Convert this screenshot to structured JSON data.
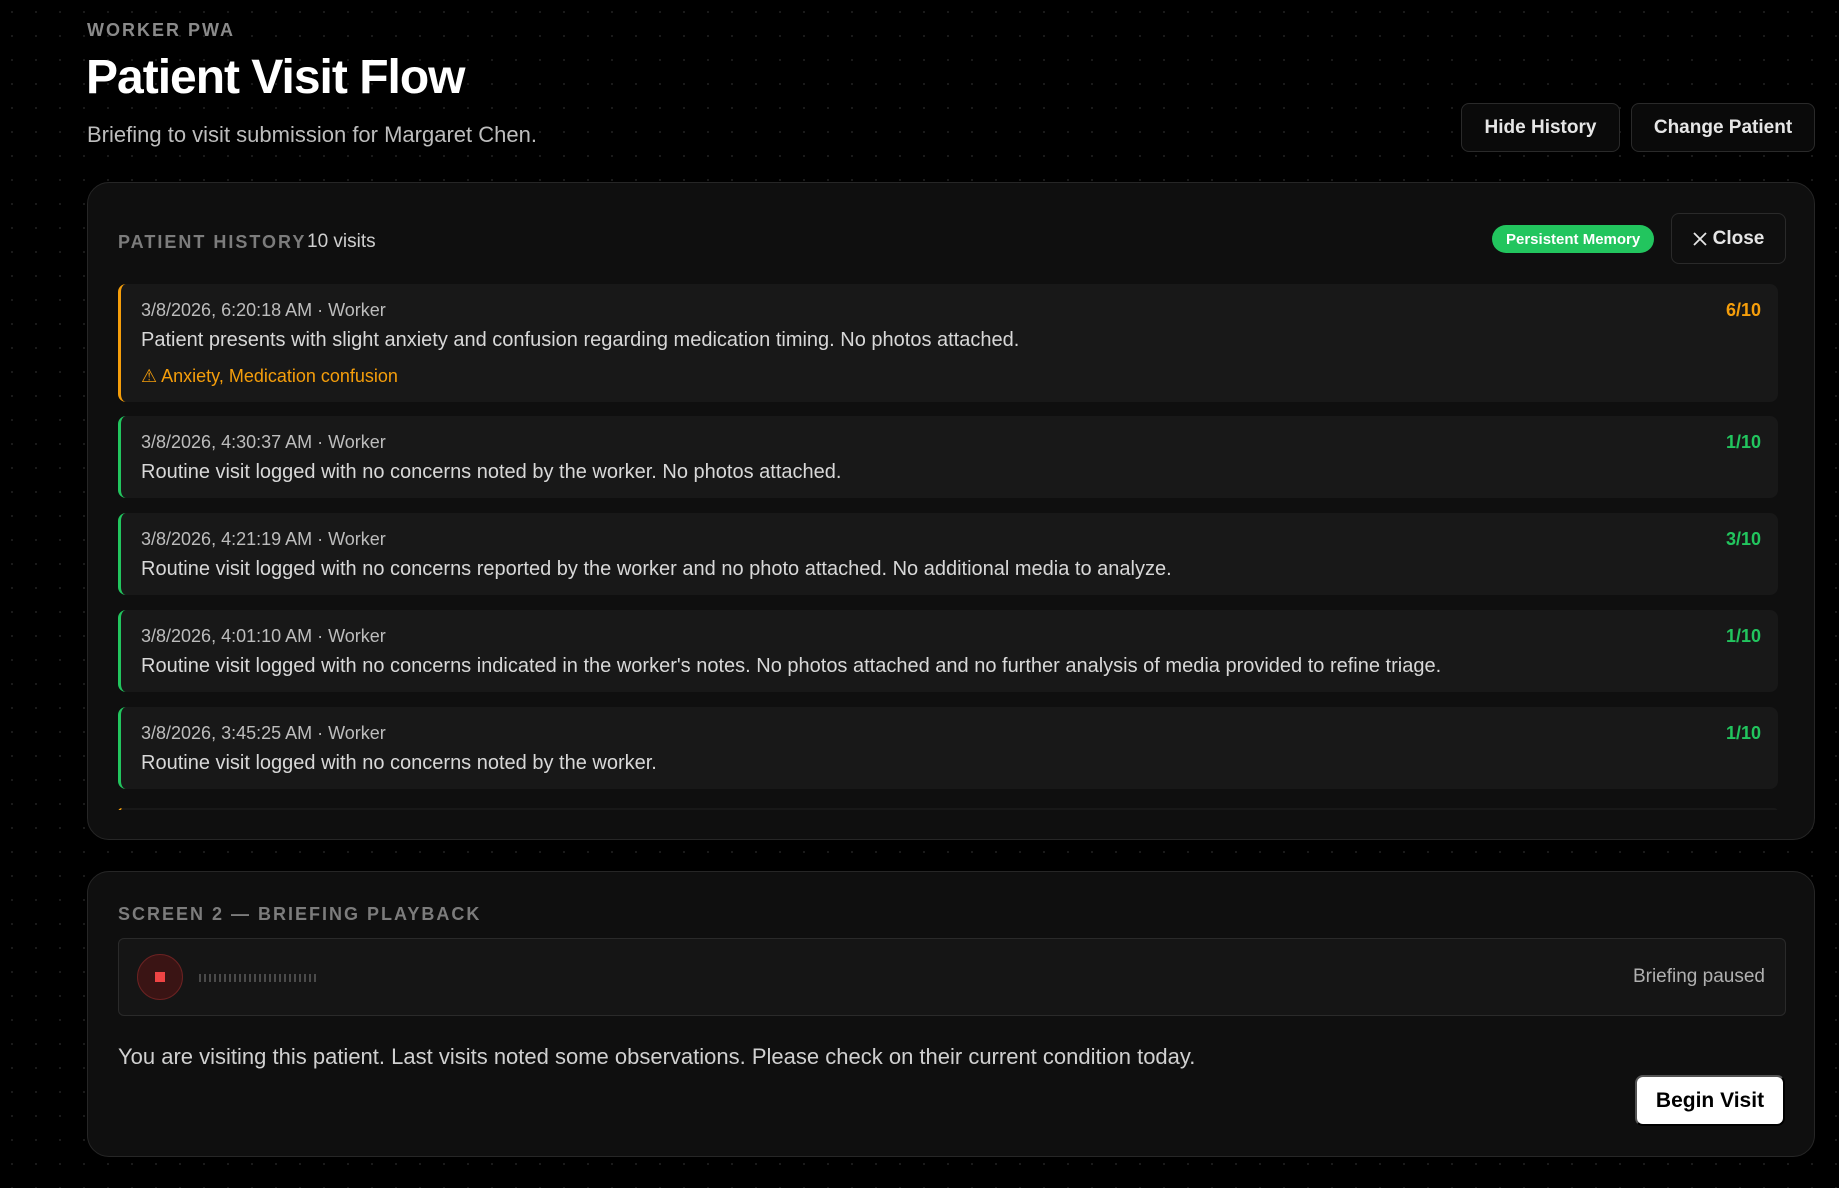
{
  "header": {
    "eyebrow": "WORKER PWA",
    "title": "Patient Visit Flow",
    "subtitle": "Briefing to visit submission for Margaret Chen.",
    "hide_history_label": "Hide History",
    "change_patient_label": "Change Patient"
  },
  "history": {
    "label": "PATIENT HISTORY",
    "count": "10 visits",
    "badge": "Persistent Memory",
    "close_label": "Close",
    "visits": [
      {
        "meta": "3/8/2026, 6:20:18 AM · Worker",
        "text": "Patient presents with slight anxiety and confusion regarding medication timing. No photos attached.",
        "score": "6/10",
        "flags": "Anxiety, Medication confusion"
      },
      {
        "meta": "3/8/2026, 4:30:37 AM · Worker",
        "text": "Routine visit logged with no concerns noted by the worker. No photos attached.",
        "score": "1/10"
      },
      {
        "meta": "3/8/2026, 4:21:19 AM · Worker",
        "text": "Routine visit logged with no concerns reported by the worker and no photo attached. No additional media to analyze.",
        "score": "3/10"
      },
      {
        "meta": "3/8/2026, 4:01:10 AM · Worker",
        "text": "Routine visit logged with no concerns indicated in the worker's notes. No photos attached and no further analysis of media provided to refine triage.",
        "score": "1/10"
      },
      {
        "meta": "3/8/2026, 3:45:25 AM · Worker",
        "text": "Routine visit logged with no concerns noted by the worker.",
        "score": "1/10"
      }
    ]
  },
  "briefing": {
    "label": "SCREEN 2 — BRIEFING PLAYBACK",
    "status": "Briefing paused",
    "text": "You are visiting this patient. Last visits noted some observations. Please check on their current condition today.",
    "begin_label": "Begin Visit"
  },
  "colors": {
    "accent_green": "#22c55e",
    "warning_amber": "#f59e0b",
    "stop_red": "#ef4444"
  }
}
